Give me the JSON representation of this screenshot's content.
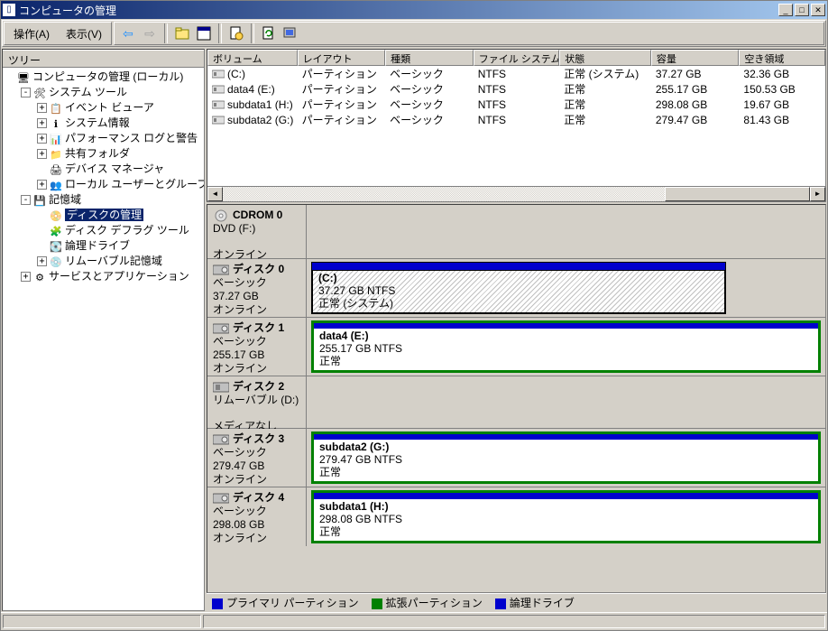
{
  "window": {
    "title": "コンピュータの管理"
  },
  "menu": {
    "action": "操作(A)",
    "view": "表示(V)"
  },
  "leftpane": {
    "header": "ツリー"
  },
  "tree": {
    "root": "コンピュータの管理 (ローカル)",
    "systools": "システム ツール",
    "eventviewer": "イベント ビューア",
    "sysinfo": "システム情報",
    "perflog": "パフォーマンス ログと警告",
    "shared": "共有フォルダ",
    "devmgr": "デバイス マネージャ",
    "localusers": "ローカル ユーザーとグループ",
    "storage": "記憶域",
    "diskmgmt": "ディスクの管理",
    "defrag": "ディスク デフラグ ツール",
    "logical": "論理ドライブ",
    "removable": "リムーバブル記憶域",
    "services": "サービスとアプリケーション"
  },
  "columns": {
    "volume": "ボリューム",
    "layout": "レイアウト",
    "type": "種類",
    "fs": "ファイル システム",
    "status": "状態",
    "capacity": "容量",
    "free": "空き領域"
  },
  "volumes": [
    {
      "name": "(C:)",
      "layout": "パーティション",
      "type": "ベーシック",
      "fs": "NTFS",
      "status": "正常 (システム)",
      "capacity": "37.27 GB",
      "free": "32.36 GB"
    },
    {
      "name": "data4 (E:)",
      "layout": "パーティション",
      "type": "ベーシック",
      "fs": "NTFS",
      "status": "正常",
      "capacity": "255.17 GB",
      "free": "150.53 GB"
    },
    {
      "name": "subdata1 (H:)",
      "layout": "パーティション",
      "type": "ベーシック",
      "fs": "NTFS",
      "status": "正常",
      "capacity": "298.08 GB",
      "free": "19.67 GB"
    },
    {
      "name": "subdata2 (G:)",
      "layout": "パーティション",
      "type": "ベーシック",
      "fs": "NTFS",
      "status": "正常",
      "capacity": "279.47 GB",
      "free": "81.43 GB"
    }
  ],
  "disks": {
    "cdrom": {
      "title": "CDROM 0",
      "line1": "DVD (F:)",
      "line2": "",
      "status": "オンライン"
    },
    "d0": {
      "title": "ディスク 0",
      "type": "ベーシック",
      "size": "37.27 GB",
      "status": "オンライン",
      "part": {
        "name": "(C:)",
        "info": "37.27 GB NTFS",
        "state": "正常 (システム)"
      }
    },
    "d1": {
      "title": "ディスク 1",
      "type": "ベーシック",
      "size": "255.17 GB",
      "status": "オンライン",
      "part": {
        "name": "data4  (E:)",
        "info": "255.17 GB NTFS",
        "state": "正常"
      }
    },
    "d2": {
      "title": "ディスク 2",
      "type": "リムーバブル (D:)",
      "size": "",
      "status": "メディアなし"
    },
    "d3": {
      "title": "ディスク 3",
      "type": "ベーシック",
      "size": "279.47 GB",
      "status": "オンライン",
      "part": {
        "name": "subdata2  (G:)",
        "info": "279.47 GB NTFS",
        "state": "正常"
      }
    },
    "d4": {
      "title": "ディスク 4",
      "type": "ベーシック",
      "size": "298.08 GB",
      "status": "オンライン",
      "part": {
        "name": "subdata1  (H:)",
        "info": "298.08 GB NTFS",
        "state": "正常"
      }
    }
  },
  "legend": {
    "primary": "プライマリ パーティション",
    "extended": "拡張パーティション",
    "logical": "論理ドライブ"
  }
}
